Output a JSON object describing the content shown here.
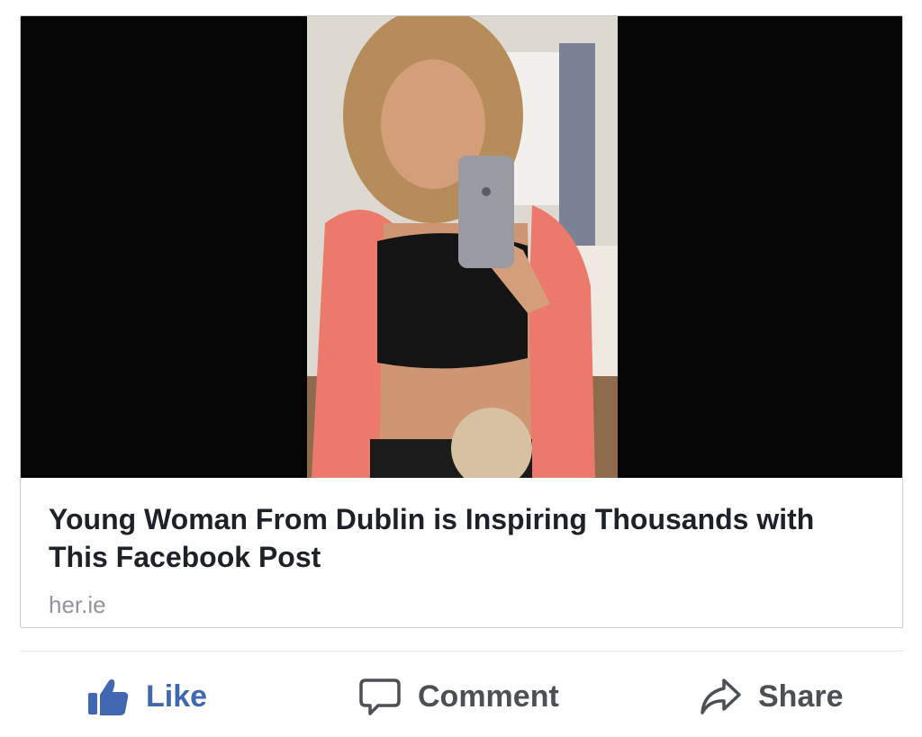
{
  "post": {
    "link": {
      "headline": "Young Woman From Dublin is Inspiring Thousands with This Facebook Post",
      "domain": "her.ie"
    },
    "actions": {
      "like_label": "Like",
      "comment_label": "Comment",
      "share_label": "Share"
    }
  },
  "colors": {
    "like_accent": "#4267b2",
    "action_text": "#4b4f56",
    "headline_text": "#1d2129",
    "domain_text": "#90949c"
  },
  "icons": {
    "like": "thumbs-up-icon",
    "comment": "speech-bubble-icon",
    "share": "share-arrow-icon"
  }
}
